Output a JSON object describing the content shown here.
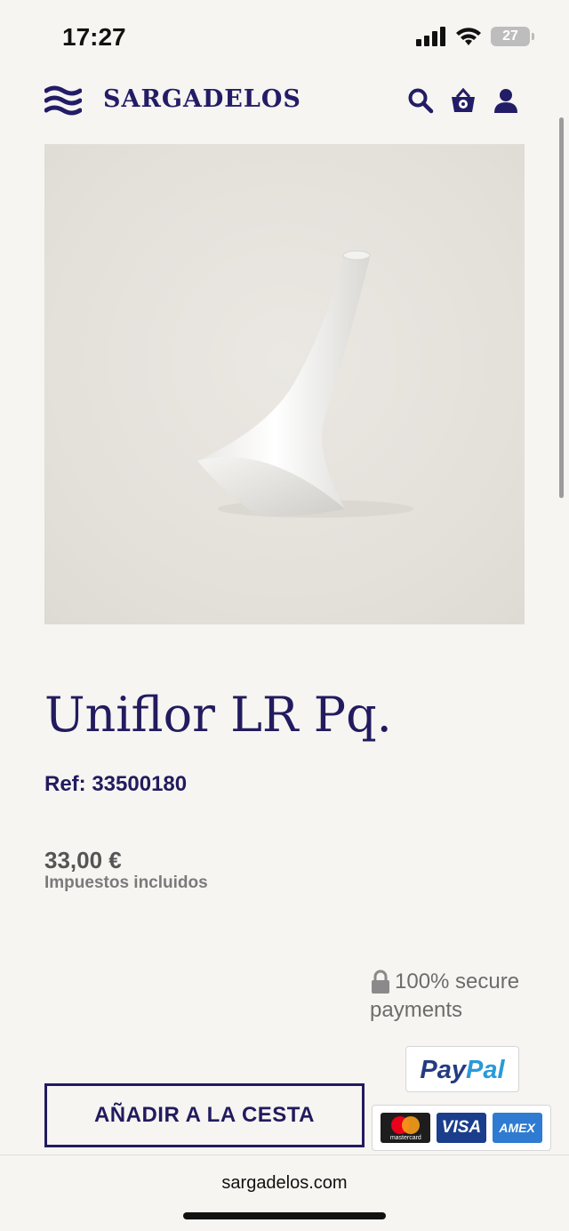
{
  "status": {
    "time": "17:27",
    "battery": "27"
  },
  "header": {
    "brand": "SARGADELOS",
    "icons": [
      "menu-icon",
      "search-icon",
      "basket-icon",
      "user-icon"
    ]
  },
  "product": {
    "image_alt": "white porcelain vase",
    "title": "Uniflor LR Pq.",
    "ref": "Ref: 33500180",
    "price": "33,00 €",
    "tax_note": "Impuestos incluidos"
  },
  "payments": {
    "secure_line1": "100% secure",
    "secure_line2": "payments",
    "paypal_pay": "Pay",
    "paypal_pal": "Pal",
    "mastercard_label": "mastercard",
    "visa_label": "VISA",
    "amex_label": "AMEX"
  },
  "actions": {
    "add_to_cart": "AÑADIR A LA CESTA"
  },
  "browser": {
    "url": "sargadelos.com"
  },
  "colors": {
    "brand": "#221b5e",
    "background": "#f6f5f2"
  }
}
